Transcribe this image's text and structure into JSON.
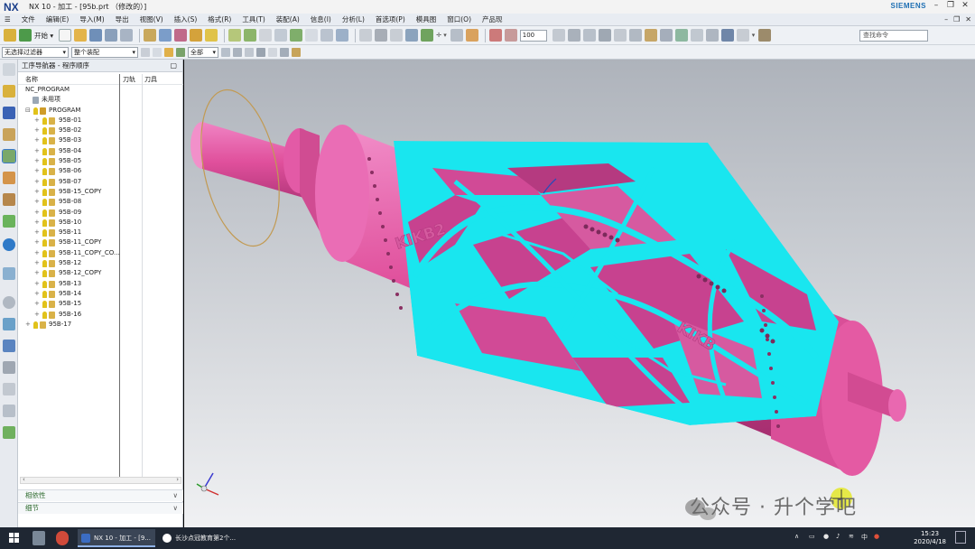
{
  "window": {
    "logo": "NX",
    "title": "NX 10 - 加工 - [95b.prt （修改的）]",
    "brand": "SIEMENS"
  },
  "menu": {
    "items": [
      "文件",
      "编辑(E)",
      "导入(M)",
      "导出",
      "视图(V)",
      "插入(S)",
      "格式(R)",
      "工具(T)",
      "装配(A)",
      "信息(I)",
      "分析(L)",
      "首选项(P)",
      "模具图",
      "窗口(O)",
      "产品现"
    ]
  },
  "toolbar": {
    "start_label": "开始 ▾",
    "zoom_value": "100",
    "search_placeholder": "查找命令"
  },
  "selection_bar": {
    "filter_value": "无选择过滤器",
    "scope_value": "整个装配",
    "snap_value": "全部"
  },
  "navigator": {
    "title": "工序导航器 - 程序顺序",
    "col_name": "名称",
    "col_toolchange": "刀轨",
    "col_tool": "刀具",
    "root": "NC_PROGRAM",
    "unused": "未用项",
    "program": "PROGRAM",
    "operations": [
      "95B-01",
      "95B-02",
      "95B-03",
      "95B-04",
      "95B-05",
      "95B-06",
      "95B-07",
      "95B-15_COPY",
      "95B-08",
      "95B-09",
      "95B-10",
      "95B-11",
      "95B-11_COPY",
      "95B-11_COPY_CO...",
      "95B-12",
      "95B-12_COPY",
      "95B-13",
      "95B-14",
      "95B-15",
      "95B-16"
    ],
    "last_program": "95B-17",
    "dependencies": "相依性",
    "details": "细节"
  },
  "model": {
    "engraving_text_1": "KIKB2",
    "engraving_text_2": "KIKB",
    "body_color": "#e0509c",
    "toolpath_color": "#19e6ef"
  },
  "watermark": "公众号 · 升个学吧",
  "taskbar": {
    "task1": "NX 10 - 加工 - [9...",
    "task2": "长沙点冠教育第2个...",
    "tray_lang": "中",
    "time": "15:23",
    "date": "2020/4/18"
  }
}
